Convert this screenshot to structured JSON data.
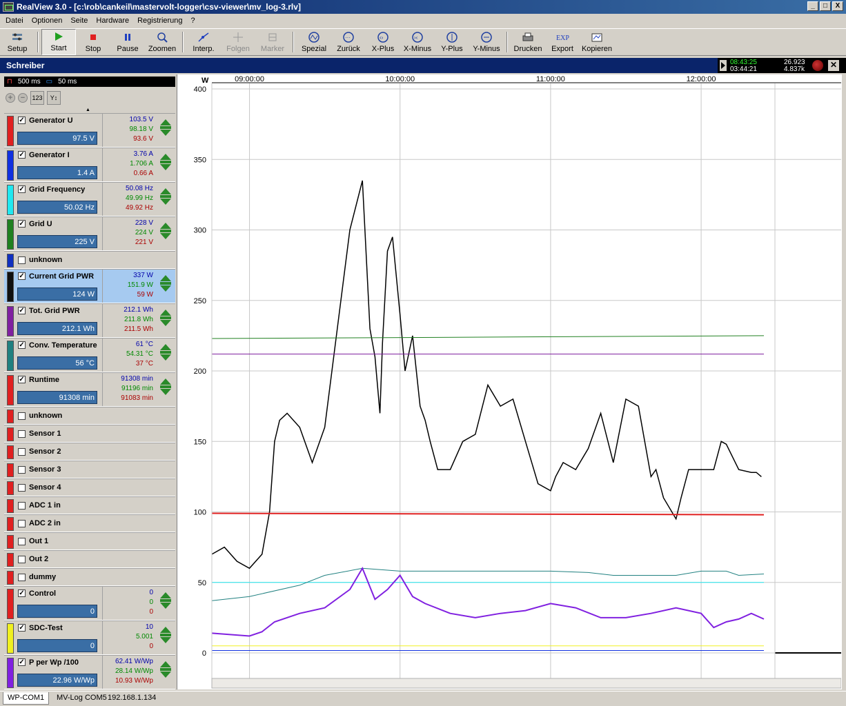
{
  "window": {
    "title": "RealView 3.0 - [c:\\rob\\cankeil\\mastervolt-logger\\csv-viewer\\mv_log-3.rlv]",
    "buttons": [
      "_",
      "□",
      "X"
    ]
  },
  "menu": [
    "Datei",
    "Optionen",
    "Seite",
    "Hardware",
    "Registrierung",
    "?"
  ],
  "toolbar": [
    {
      "label": "Setup",
      "icon": "setup-icon"
    },
    {
      "label": "Start",
      "icon": "play-icon",
      "pressed": true
    },
    {
      "label": "Stop",
      "icon": "stop-icon"
    },
    {
      "label": "Pause",
      "icon": "pause-icon"
    },
    {
      "label": "Zoomen",
      "icon": "zoom-icon"
    },
    {
      "label": "Interp.",
      "icon": "interp-icon"
    },
    {
      "label": "Folgen",
      "icon": "follow-icon",
      "disabled": true
    },
    {
      "label": "Marker",
      "icon": "marker-icon",
      "disabled": true
    },
    {
      "label": "Spezial",
      "icon": "special-icon"
    },
    {
      "label": "Zurück",
      "icon": "back-icon"
    },
    {
      "label": "X-Plus",
      "icon": "x-plus-icon"
    },
    {
      "label": "X-Minus",
      "icon": "x-minus-icon"
    },
    {
      "label": "Y-Plus",
      "icon": "y-plus-icon"
    },
    {
      "label": "Y-Minus",
      "icon": "y-minus-icon"
    },
    {
      "label": "Drucken",
      "icon": "print-icon"
    },
    {
      "label": "Export",
      "icon": "export-icon"
    },
    {
      "label": "Kopieren",
      "icon": "copy-icon"
    }
  ],
  "schreiber": {
    "title": "Schreiber",
    "time1": "08:43:25",
    "time2": "03:44:21",
    "val1": "26.923",
    "val2": "4.837k"
  },
  "rates": {
    "sample": "500 ms",
    "display": "50 ms"
  },
  "channels": [
    {
      "name": "Generator U",
      "checked": true,
      "color": "#e02020",
      "value": "97.5 V",
      "max": "103.5 V",
      "avg": "98.18 V",
      "min": "93.6 V",
      "big": true
    },
    {
      "name": "Generator I",
      "checked": true,
      "color": "#1030e0",
      "value": "1.4 A",
      "max": "3.76 A",
      "avg": "1.706 A",
      "min": "0.66 A",
      "big": true
    },
    {
      "name": "Grid Frequency",
      "checked": true,
      "color": "#20e8f0",
      "value": "50.02 Hz",
      "max": "50.08 Hz",
      "avg": "49.99 Hz",
      "min": "49.92 Hz",
      "big": true
    },
    {
      "name": "Grid U",
      "checked": true,
      "color": "#208020",
      "value": "225 V",
      "max": "228 V",
      "avg": "224 V",
      "min": "221 V",
      "big": true
    },
    {
      "name": "unknown",
      "checked": false,
      "color": "#1030c0",
      "big": false
    },
    {
      "name": "Current Grid PWR",
      "checked": true,
      "color": "#101010",
      "value": "124 W",
      "max": "337 W",
      "avg": "151.9 W",
      "min": "59 W",
      "big": true,
      "highlight": true
    },
    {
      "name": "Tot. Grid PWR",
      "checked": true,
      "color": "#8020a0",
      "value": "212.1 Wh",
      "max": "212.1 Wh",
      "avg": "211.8 Wh",
      "min": "211.5 Wh",
      "big": true
    },
    {
      "name": "Conv. Temperature",
      "checked": true,
      "color": "#208080",
      "value": "56 °C",
      "max": "61 °C",
      "avg": "54.31 °C",
      "min": "37 °C",
      "big": true
    },
    {
      "name": "Runtime",
      "checked": true,
      "color": "#e02020",
      "value": "91308 min",
      "max": "91308 min",
      "avg": "91196 min",
      "min": "91083 min",
      "big": true
    },
    {
      "name": "unknown",
      "checked": false,
      "color": "#e02020",
      "big": false
    },
    {
      "name": "Sensor 1",
      "checked": false,
      "color": "#e02020",
      "big": false
    },
    {
      "name": "Sensor 2",
      "checked": false,
      "color": "#e02020",
      "big": false
    },
    {
      "name": "Sensor 3",
      "checked": false,
      "color": "#e02020",
      "big": false
    },
    {
      "name": "Sensor 4",
      "checked": false,
      "color": "#e02020",
      "big": false
    },
    {
      "name": "ADC 1 in",
      "checked": false,
      "color": "#e02020",
      "big": false
    },
    {
      "name": "ADC 2 in",
      "checked": false,
      "color": "#e02020",
      "big": false
    },
    {
      "name": "Out 1",
      "checked": false,
      "color": "#e02020",
      "big": false
    },
    {
      "name": "Out 2",
      "checked": false,
      "color": "#e02020",
      "big": false
    },
    {
      "name": "dummy",
      "checked": false,
      "color": "#e02020",
      "big": false
    },
    {
      "name": "Control",
      "checked": true,
      "color": "#e02020",
      "value": "0",
      "max": "0",
      "avg": "0",
      "min": "0",
      "big": true
    },
    {
      "name": "SDC-Test",
      "checked": true,
      "color": "#f0f020",
      "value": "0",
      "max": "10",
      "avg": "5.001",
      "min": "0",
      "big": true
    },
    {
      "name": "P per Wp /100",
      "checked": true,
      "color": "#8020e0",
      "value": "22.96 W/Wp",
      "max": "62.41 W/Wp",
      "avg": "28.14 W/Wp",
      "min": "10.93 W/Wp",
      "big": true
    }
  ],
  "chart_data": {
    "type": "line",
    "ylabel": "W",
    "ylim": [
      0,
      400
    ],
    "yticks": [
      "400",
      "350",
      "300",
      "250",
      "200",
      "150",
      "100",
      "50",
      "0"
    ],
    "xlim": [
      "08:45:00",
      "12:25:00"
    ],
    "xticks": [
      "09:00:00",
      "10:00:00",
      "11:00:00",
      "12:00:00"
    ],
    "grid": true,
    "series": [
      {
        "name": "Current Grid PWR",
        "color": "#000000",
        "x": [
          "08:45",
          "08:50",
          "08:55",
          "09:00",
          "09:05",
          "09:08",
          "09:10",
          "09:12",
          "09:15",
          "09:20",
          "09:25",
          "09:30",
          "09:35",
          "09:40",
          "09:45",
          "09:48",
          "09:50",
          "09:52",
          "09:53",
          "09:55",
          "09:57",
          "10:00",
          "10:02",
          "10:05",
          "10:08",
          "10:10",
          "10:12",
          "10:15",
          "10:20",
          "10:25",
          "10:30",
          "10:35",
          "10:40",
          "10:45",
          "10:50",
          "10:55",
          "11:00",
          "11:02",
          "11:05",
          "11:10",
          "11:15",
          "11:20",
          "11:25",
          "11:30",
          "11:35",
          "11:40",
          "11:42",
          "11:45",
          "11:50",
          "11:52",
          "11:55",
          "12:00",
          "12:05",
          "12:08",
          "12:10",
          "12:15",
          "12:20",
          "12:22",
          "12:24"
        ],
        "y": [
          70,
          75,
          65,
          60,
          70,
          100,
          150,
          165,
          170,
          160,
          135,
          160,
          230,
          300,
          335,
          230,
          210,
          170,
          220,
          285,
          295,
          240,
          200,
          225,
          175,
          165,
          150,
          130,
          130,
          150,
          155,
          190,
          175,
          180,
          150,
          120,
          115,
          125,
          135,
          130,
          145,
          170,
          135,
          180,
          175,
          125,
          130,
          110,
          95,
          110,
          130,
          130,
          130,
          150,
          148,
          130,
          128,
          128,
          125
        ]
      },
      {
        "name": "Grid U",
        "color": "#208020",
        "x": [
          "08:45",
          "12:25"
        ],
        "y": [
          223,
          225
        ]
      },
      {
        "name": "Tot. Grid PWR",
        "color": "#8020a0",
        "x": [
          "08:45",
          "12:25"
        ],
        "y": [
          212,
          212
        ]
      },
      {
        "name": "Generator U",
        "color": "#e02020",
        "x": [
          "08:45",
          "12:25"
        ],
        "y": [
          99,
          98
        ]
      },
      {
        "name": "Grid Frequency",
        "color": "#20e8f0",
        "x": [
          "08:45",
          "12:25"
        ],
        "y": [
          50,
          50
        ]
      },
      {
        "name": "Conv. Temperature",
        "color": "#208080",
        "x": [
          "08:45",
          "09:00",
          "09:20",
          "09:30",
          "09:45",
          "10:00",
          "10:30",
          "11:00",
          "11:15",
          "11:25",
          "11:35",
          "11:50",
          "12:00",
          "12:10",
          "12:15",
          "12:25"
        ],
        "y": [
          37,
          40,
          48,
          55,
          60,
          58,
          58,
          58,
          57,
          55,
          55,
          55,
          58,
          58,
          55,
          56
        ]
      },
      {
        "name": "P per Wp /100",
        "color": "#8020e0",
        "x": [
          "08:45",
          "09:00",
          "09:05",
          "09:10",
          "09:20",
          "09:30",
          "09:40",
          "09:45",
          "09:50",
          "09:55",
          "10:00",
          "10:05",
          "10:10",
          "10:20",
          "10:30",
          "10:40",
          "10:50",
          "11:00",
          "11:10",
          "11:20",
          "11:30",
          "11:40",
          "11:50",
          "12:00",
          "12:05",
          "12:10",
          "12:15",
          "12:20",
          "12:25"
        ],
        "y": [
          14,
          12,
          15,
          22,
          28,
          32,
          45,
          60,
          38,
          45,
          55,
          40,
          35,
          28,
          25,
          28,
          30,
          35,
          32,
          25,
          25,
          28,
          32,
          28,
          18,
          22,
          24,
          28,
          24
        ]
      },
      {
        "name": "SDC-Test",
        "color": "#f0f020",
        "x": [
          "08:45",
          "12:25"
        ],
        "y": [
          5,
          5
        ]
      },
      {
        "name": "Generator I",
        "color": "#1030e0",
        "x": [
          "08:45",
          "12:25"
        ],
        "y": [
          1.7,
          1.7
        ]
      }
    ]
  },
  "statusbar": {
    "tab1": "WP-COM1",
    "tab2": "MV-Log COM5",
    "ip": "192.168.1.134"
  }
}
